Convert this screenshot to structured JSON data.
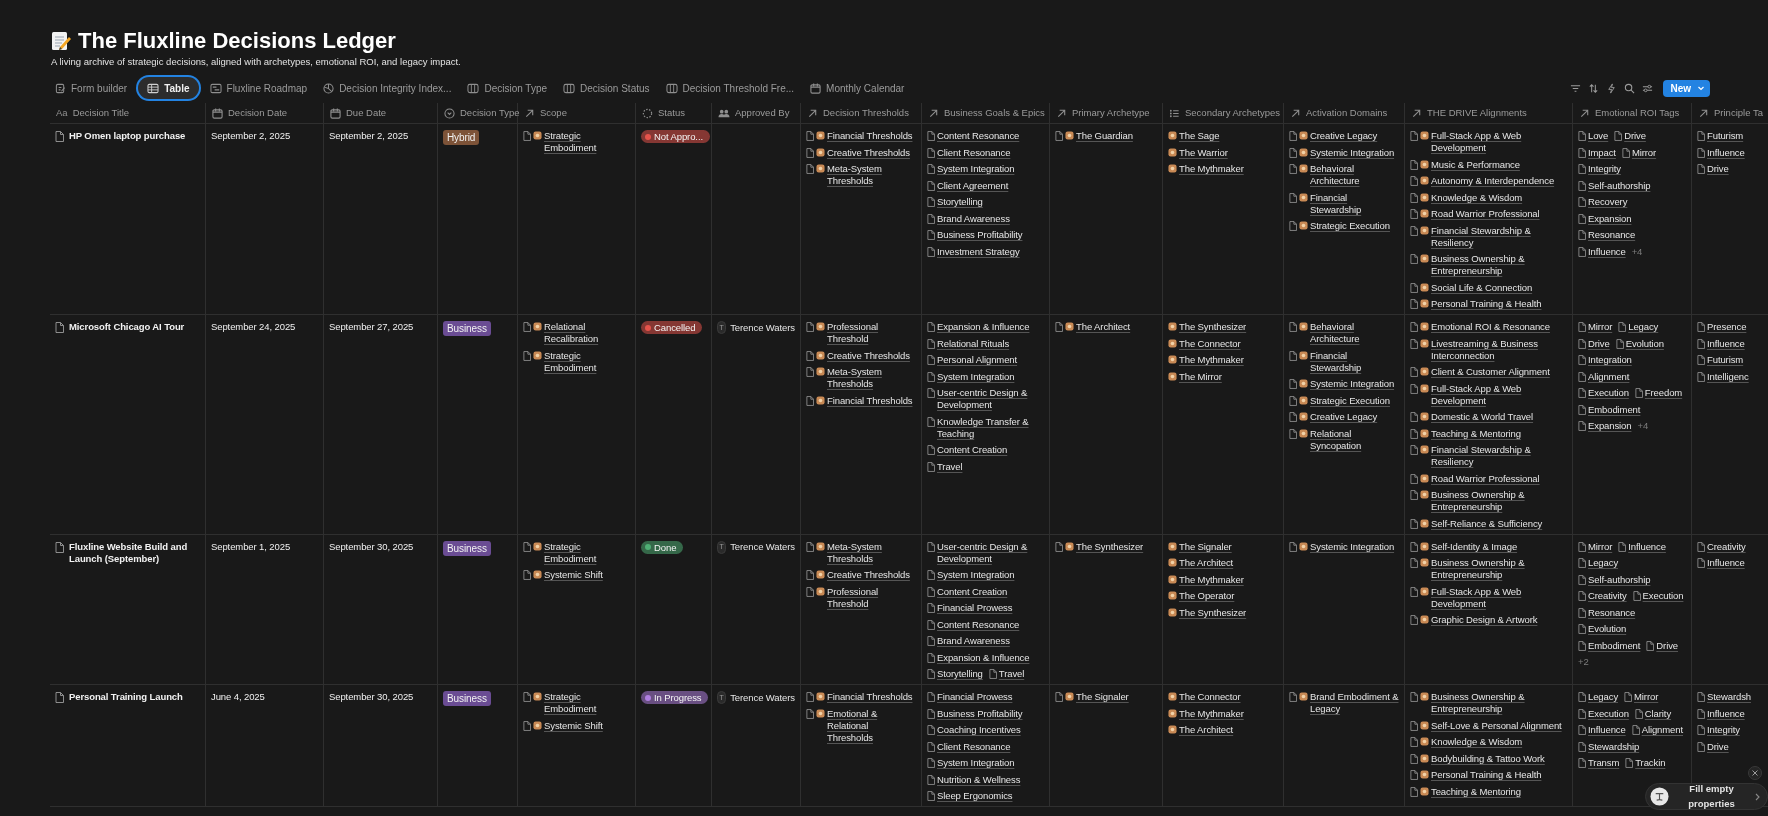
{
  "page": {
    "title": "The Fluxline Decisions Ledger",
    "description": "A living archive of strategic decisions, aligned with archetypes, emotional ROI, and legacy impact."
  },
  "views": [
    {
      "label": "Form builder",
      "kind": "form",
      "selected": false
    },
    {
      "label": "Table",
      "kind": "table",
      "selected": true
    },
    {
      "label": "Fluxline Roadmap",
      "kind": "timeline",
      "selected": false
    },
    {
      "label": "Decision Integrity Index...",
      "kind": "chart",
      "selected": false
    },
    {
      "label": "Decision Type",
      "kind": "board",
      "selected": false
    },
    {
      "label": "Decision Status",
      "kind": "board",
      "selected": false
    },
    {
      "label": "Decision Threshold Fre...",
      "kind": "board",
      "selected": false
    },
    {
      "label": "Monthly Calendar",
      "kind": "calendar",
      "selected": false
    }
  ],
  "toolbar": {
    "new_button": "New"
  },
  "table": {
    "columns": [
      {
        "label": "Decision Title",
        "kind": "title",
        "glyph": "Aa"
      },
      {
        "label": "Decision Date",
        "kind": "date"
      },
      {
        "label": "Due Date",
        "kind": "date"
      },
      {
        "label": "Decision Type",
        "kind": "select"
      },
      {
        "label": "Scope",
        "kind": "relation_emoji"
      },
      {
        "label": "Status",
        "kind": "status"
      },
      {
        "label": "Approved By",
        "kind": "person"
      },
      {
        "label": "Decision Thresholds",
        "kind": "relation_emoji"
      },
      {
        "label": "Business Goals & Epics",
        "kind": "relation"
      },
      {
        "label": "Primary Archetype",
        "kind": "relation_emoji"
      },
      {
        "label": "Secondary Archetypes",
        "kind": "multi_select"
      },
      {
        "label": "Activation Domains",
        "kind": "relation_emoji"
      },
      {
        "label": "THE DRIVE Alignments",
        "kind": "relation_emoji"
      },
      {
        "label": "Emotional ROI Tags",
        "kind": "relation"
      },
      {
        "label": "Principle Ta",
        "kind": "relation"
      }
    ],
    "rows": [
      {
        "cells": [
          "HP Omen laptop purchase",
          "September 2, 2025",
          "September 2, 2025",
          {
            "label": "Hybrid",
            "color": "#7d5338"
          },
          {
            "items": [
              "Strategic Embodiment"
            ]
          },
          {
            "label": "Not Appro...",
            "color": "#e5534b"
          },
          null,
          {
            "items": [
              "Financial Thresholds",
              "Creative Thresholds",
              "Meta-System Thresholds"
            ]
          },
          {
            "items": [
              "Content Resonance",
              "Client Resonance",
              "System Integration",
              "Client Agreement",
              "Storytelling",
              "Brand Awareness",
              "Business Profitability",
              "Investment Strategy"
            ]
          },
          {
            "items": [
              "The Guardian"
            ]
          },
          {
            "items": [
              "The Sage",
              "The Warrior",
              "The Mythmaker"
            ]
          },
          {
            "items": [
              "Creative Legacy",
              "Systemic Integration",
              "Behavioral Architecture",
              "Financial Stewardship",
              "Strategic Execution"
            ]
          },
          {
            "items": [
              "Full-Stack App & Web Development",
              "Music & Performance",
              "Autonomy & Interdependence",
              "Knowledge & Wisdom",
              "Road Warrior Professional",
              "Financial Stewardship & Resiliency",
              "Business Ownership & Entrepreneurship",
              "Social Life & Connection",
              "Personal Training & Health"
            ]
          },
          {
            "items": [
              "Love",
              "Drive",
              "Impact",
              "Mirror",
              "Integrity",
              "Self-authorship",
              "Recovery",
              "Expansion",
              "Resonance",
              "Influence"
            ],
            "more": "+4"
          },
          {
            "items": [
              "Futurism",
              "Influence",
              "Drive"
            ]
          }
        ]
      },
      {
        "cells": [
          "Microsoft Chicago AI Tour",
          "September 24, 2025",
          "September 27, 2025",
          {
            "label": "Business",
            "color": "#6a4c93"
          },
          {
            "items": [
              "Relational Recalibration",
              "Strategic Embodiment"
            ]
          },
          {
            "label": "Cancelled",
            "color": "#e5534b"
          },
          {
            "initial": "T",
            "name": "Terence Waters"
          },
          {
            "items": [
              "Professional Threshold",
              "Creative Thresholds",
              "Meta-System Thresholds",
              "Financial Thresholds"
            ]
          },
          {
            "items": [
              "Expansion & Influence",
              "Relational Rituals",
              "Personal Alignment",
              "System Integration",
              "User-centric Design & Development",
              "Knowledge Transfer & Teaching",
              "Content Creation",
              "Travel"
            ]
          },
          {
            "items": [
              "The Architect"
            ]
          },
          {
            "items": [
              "The Synthesizer",
              "The Connector",
              "The Mythmaker",
              "The Mirror"
            ]
          },
          {
            "items": [
              "Behavioral Architecture",
              "Financial Stewardship",
              "Systemic Integration",
              "Strategic Execution",
              "Creative Legacy",
              "Relational Syncopation"
            ]
          },
          {
            "items": [
              "Emotional ROI & Resonance",
              "Livestreaming & Business Interconnection",
              "Client & Customer Alignment",
              "Full-Stack App & Web Development",
              "Domestic & World Travel",
              "Teaching & Mentoring",
              "Financial Stewardship & Resiliency",
              "Road Warrior Professional",
              "Business Ownership & Entrepreneurship",
              "Self-Reliance & Sufficiency"
            ]
          },
          {
            "items": [
              "Mirror",
              "Legacy",
              "Drive",
              "Evolution",
              "Integration",
              "Alignment",
              "Execution",
              "Freedom",
              "Embodiment",
              "Expansion"
            ],
            "more": "+4"
          },
          {
            "items": [
              "Presence",
              "Influence",
              "Futurism",
              "Intelligenc"
            ]
          }
        ]
      },
      {
        "cells": [
          "Fluxline Website Build and Launch (September)",
          "September 1, 2025",
          "September 30, 2025",
          {
            "label": "Business",
            "color": "#6a4c93"
          },
          {
            "items": [
              "Strategic Embodiment",
              "Systemic Shift"
            ]
          },
          {
            "label": "Done",
            "color": "#4fae74"
          },
          {
            "initial": "T",
            "name": "Terence Waters"
          },
          {
            "items": [
              "Meta-System Thresholds",
              "Creative Thresholds",
              "Professional Threshold"
            ]
          },
          {
            "items": [
              "User-centric Design & Development",
              "System Integration",
              "Content Creation",
              "Financial Prowess",
              "Content Resonance",
              "Brand Awareness",
              "Expansion & Influence",
              "Storytelling",
              "Travel"
            ]
          },
          {
            "items": [
              "The Synthesizer"
            ]
          },
          {
            "items": [
              "The Signaler",
              "The Architect",
              "The Mythmaker",
              "The Operator",
              "The Synthesizer"
            ]
          },
          {
            "items": [
              "Systemic Integration"
            ]
          },
          {
            "items": [
              "Self-Identity & Image",
              "Business Ownership & Entrepreneurship",
              "Full-Stack App & Web Development",
              "Graphic Design & Artwork"
            ]
          },
          {
            "items": [
              "Mirror",
              "Influence",
              "Legacy",
              "Self-authorship",
              "Creativity",
              "Execution",
              "Resonance",
              "Evolution",
              "Embodiment",
              "Drive"
            ],
            "more": "+2"
          },
          {
            "items": [
              "Creativity",
              "Influence"
            ]
          }
        ]
      },
      {
        "cells": [
          "Personal Training Launch",
          "June 4, 2025",
          "September 30, 2025",
          {
            "label": "Business",
            "color": "#6a4c93"
          },
          {
            "items": [
              "Strategic Embodiment",
              "Systemic Shift"
            ]
          },
          {
            "label": "In Progress",
            "color": "#b07fe0"
          },
          {
            "initial": "T",
            "name": "Terence Waters"
          },
          {
            "items": [
              "Financial Thresholds",
              "Emotional & Relational Thresholds"
            ]
          },
          {
            "items": [
              "Financial Prowess",
              "Business Profitability",
              "Coaching Incentives",
              "Client Resonance",
              "System Integration",
              "Nutrition & Wellness",
              "Sleep Ergonomics"
            ]
          },
          {
            "items": [
              "The Signaler"
            ]
          },
          {
            "items": [
              "The Connector",
              "The Mythmaker",
              "The Architect"
            ]
          },
          {
            "items": [
              "Brand Embodiment & Legacy"
            ]
          },
          {
            "items": [
              "Business Ownership & Entrepreneurship",
              "Self-Love & Personal Alignment",
              "Knowledge & Wisdom",
              "Bodybuilding & Tattoo Work",
              "Personal Training & Health",
              "Teaching & Mentoring"
            ]
          },
          {
            "items": [
              "Legacy",
              "Mirror",
              "Execution",
              "Clarity",
              "Influence",
              "Alignment",
              "Stewardship",
              "Transm",
              "Trackin"
            ]
          },
          {
            "items": [
              "Stewardsh",
              "Influence",
              "Integrity",
              "Drive"
            ]
          }
        ]
      }
    ]
  },
  "assistant_prompt": {
    "label": "Fill empty properties"
  }
}
